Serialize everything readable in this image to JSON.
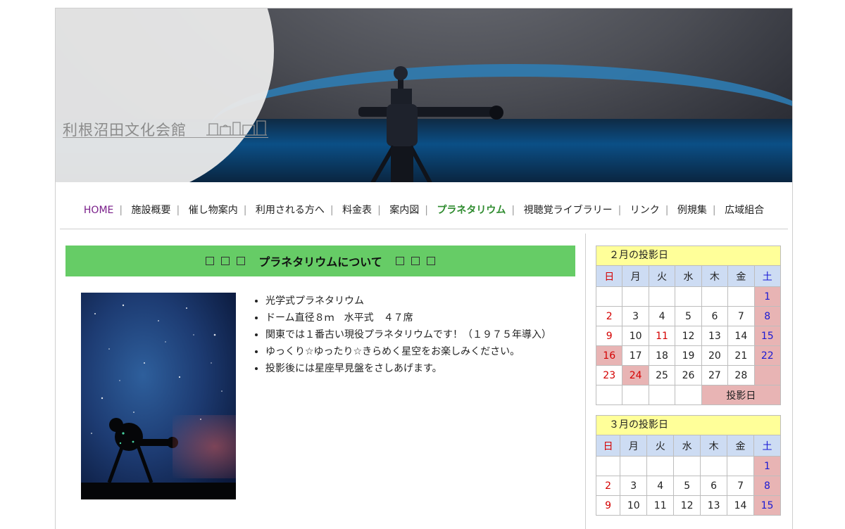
{
  "header": {
    "site_name": "利根沼田文化会館"
  },
  "nav": {
    "items": [
      "HOME",
      "施設概要",
      "催し物案内",
      "利用される方へ",
      "料金表",
      "案内図",
      "プラネタリウム",
      "視聴覚ライブラリー",
      "リンク",
      "例規集",
      "広域組合"
    ],
    "active": "プラネタリウム"
  },
  "main": {
    "title": "プラネタリウムについて",
    "features": [
      "光学式プラネタリウム",
      "ドーム直径８ｍ　水平式　４７席",
      "関東では１番古い現役プラネタリウムです！（１９７５年導入）",
      "ゆっくり☆ゆったり☆きらめく星空をお楽しみください。",
      "投影後には星座早見盤をさしあげます。"
    ]
  },
  "calendar_feb": {
    "title": "２月の投影日",
    "weekdays": [
      "日",
      "月",
      "火",
      "水",
      "木",
      "金",
      "土"
    ],
    "legend": "投影日"
  },
  "calendar_mar": {
    "title": "３月の投影日",
    "weekdays": [
      "日",
      "月",
      "火",
      "水",
      "木",
      "金",
      "土"
    ]
  },
  "colors": {
    "title_bar": "#66cc66",
    "nav_active": "#2e8b2e",
    "nav_home": "#7a1f8a",
    "calendar_header": "#ffff99",
    "calendar_weekdays": "#cddcf3",
    "projection_day": "#e8b4b4"
  }
}
